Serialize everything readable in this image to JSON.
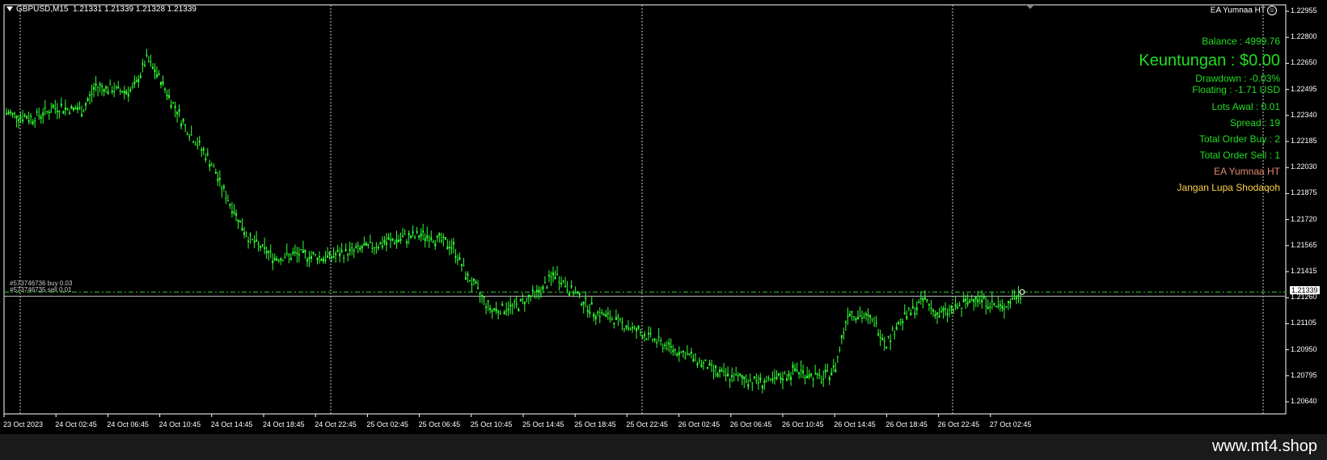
{
  "header": {
    "symbol_line": "GBPUSD,M15  1.21331 1.21339 1.21328 1.21339",
    "ea_name": "EA Yumnaa HT",
    "ea_icon": "smiley-icon"
  },
  "info_panel": {
    "balance": "Balance : 4999.76",
    "profit": "Keuntungan : $0.00",
    "drawdown": "Drawdown : -0.03%",
    "floating": "Floating : -1.71 USD",
    "lots": "Lots Awal : 0.01",
    "spread": "Spread : 19",
    "total_buy": "Total Order Buy :  2",
    "total_sell": "Total Order Sell :  1",
    "ea_label": "EA Yumnaa HT",
    "reminder": "Jangan Lupa Shodaqoh"
  },
  "orders": {
    "buy": "#573746736 buy 0.03",
    "sell": "#573746735 sell 0.01"
  },
  "current_price": "1.21339",
  "x_labels": [
    "23 Oct 2023",
    "24 Oct 02:45",
    "24 Oct 06:45",
    "24 Oct 10:45",
    "24 Oct 14:45",
    "24 Oct 18:45",
    "24 Oct 22:45",
    "25 Oct 02:45",
    "25 Oct 06:45",
    "25 Oct 10:45",
    "25 Oct 14:45",
    "25 Oct 18:45",
    "25 Oct 22:45",
    "26 Oct 02:45",
    "26 Oct 06:45",
    "26 Oct 10:45",
    "26 Oct 14:45",
    "26 Oct 18:45",
    "26 Oct 22:45",
    "27 Oct 02:45"
  ],
  "y_labels": [
    "1.22955",
    "1.22800",
    "1.22650",
    "1.22495",
    "1.22340",
    "1.22185",
    "1.22030",
    "1.21875",
    "1.21720",
    "1.21565",
    "1.21415",
    "1.21260",
    "1.21105",
    "1.20950",
    "1.20795",
    "1.20640"
  ],
  "colors": {
    "candle": "#33ff33",
    "info_green": "#22dd22",
    "ea_label": "#e58a6a",
    "reminder": "#ffd24a"
  },
  "price_path": [
    [
      0,
      1.2248
    ],
    [
      0.02,
      1.2245
    ],
    [
      0.04,
      1.2252
    ],
    [
      0.06,
      1.225
    ],
    [
      0.07,
      1.2265
    ],
    [
      0.09,
      1.2262
    ],
    [
      0.1,
      1.2263
    ],
    [
      0.11,
      1.2282
    ],
    [
      0.12,
      1.227
    ],
    [
      0.13,
      1.2255
    ],
    [
      0.14,
      1.224
    ],
    [
      0.16,
      1.2218
    ],
    [
      0.17,
      1.22
    ],
    [
      0.18,
      1.2185
    ],
    [
      0.19,
      1.217
    ],
    [
      0.21,
      1.2158
    ],
    [
      0.23,
      1.216
    ],
    [
      0.25,
      1.2158
    ],
    [
      0.27,
      1.2162
    ],
    [
      0.29,
      1.2166
    ],
    [
      0.31,
      1.217
    ],
    [
      0.33,
      1.2172
    ],
    [
      0.35,
      1.2165
    ],
    [
      0.36,
      1.2148
    ],
    [
      0.38,
      1.2125
    ],
    [
      0.4,
      1.2128
    ],
    [
      0.42,
      1.2138
    ],
    [
      0.43,
      1.2148
    ],
    [
      0.44,
      1.214
    ],
    [
      0.46,
      1.2125
    ],
    [
      0.48,
      1.2118
    ],
    [
      0.5,
      1.211
    ],
    [
      0.52,
      1.2102
    ],
    [
      0.54,
      1.2095
    ],
    [
      0.56,
      1.2085
    ],
    [
      0.58,
      1.2082
    ],
    [
      0.6,
      1.208
    ],
    [
      0.62,
      1.2088
    ],
    [
      0.64,
      1.2082
    ],
    [
      0.65,
      1.209
    ],
    [
      0.66,
      1.2125
    ],
    [
      0.68,
      1.2118
    ],
    [
      0.69,
      1.2105
    ],
    [
      0.7,
      1.2118
    ],
    [
      0.72,
      1.2132
    ],
    [
      0.73,
      1.2122
    ],
    [
      0.75,
      1.2128
    ],
    [
      0.76,
      1.2134
    ],
    [
      0.77,
      1.213
    ],
    [
      0.78,
      1.2126
    ],
    [
      0.79,
      1.2133
    ],
    [
      0.795,
      1.21339
    ]
  ]
}
